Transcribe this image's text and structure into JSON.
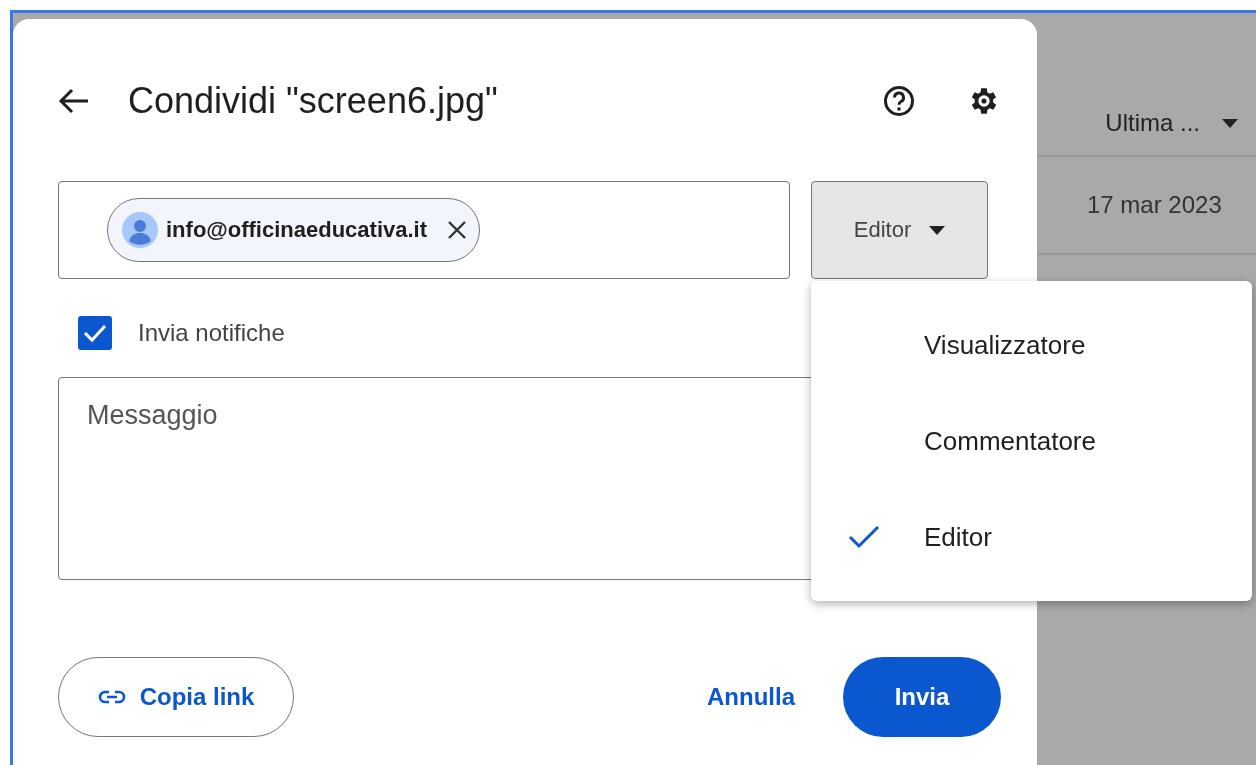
{
  "dialog": {
    "title": "Condividi \"screen6.jpg\"",
    "recipient": {
      "email": "info@officinaeducativa.it"
    },
    "role_button": {
      "label": "Editor",
      "expanded": true
    },
    "notify": {
      "label": "Invia notifiche",
      "checked": true
    },
    "message": {
      "placeholder": "Messaggio"
    },
    "copy_link": "Copia link",
    "cancel": "Annulla",
    "send": "Invia"
  },
  "role_menu": [
    {
      "label": "Visualizzatore",
      "selected": false
    },
    {
      "label": "Commentatore",
      "selected": false
    },
    {
      "label": "Editor",
      "selected": true
    }
  ],
  "background": {
    "column_header": "Ultima ...",
    "row_date": "17 mar 2023"
  }
}
